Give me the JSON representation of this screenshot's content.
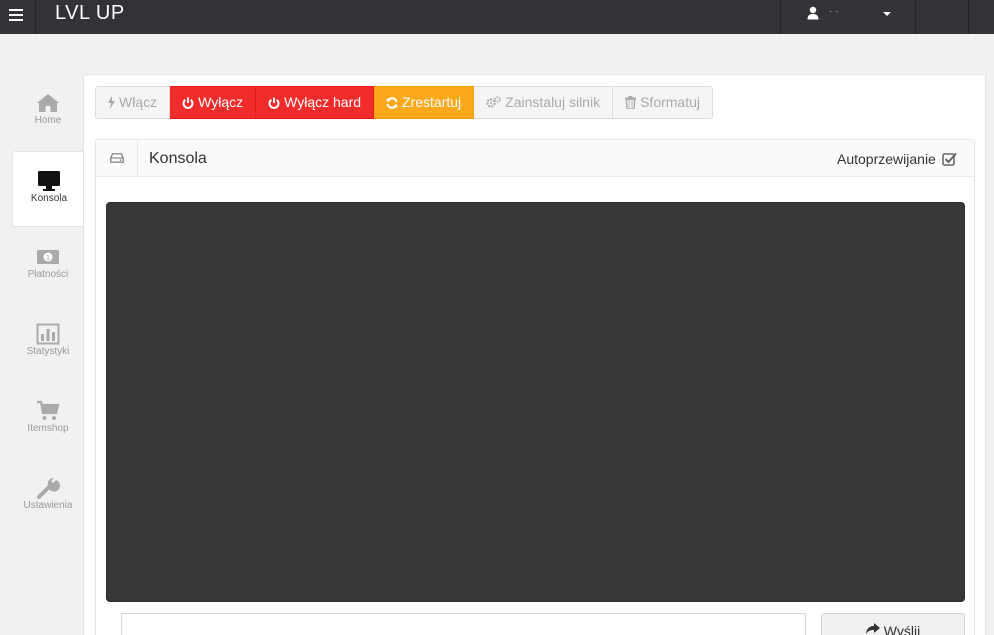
{
  "topbar": {
    "brand": "LVL UP",
    "user_name": "· ·"
  },
  "sidebar": {
    "items": [
      {
        "label": "Home",
        "icon": "home-icon",
        "active": false
      },
      {
        "label": "Konsola",
        "icon": "monitor-icon",
        "active": true
      },
      {
        "label": "Płatności",
        "icon": "money-icon",
        "active": false
      },
      {
        "label": "Statystyki",
        "icon": "bar-chart-icon",
        "active": false
      },
      {
        "label": "Itemshop",
        "icon": "cart-icon",
        "active": false
      },
      {
        "label": "Ustawienia",
        "icon": "wrench-icon",
        "active": false
      }
    ]
  },
  "toolbar": {
    "start_label": "Włącz",
    "stop_label": "Wyłącz",
    "stop_hard_label": "Wyłącz hard",
    "restart_label": "Zrestartuj",
    "install_label": "Zainstaluj silnik",
    "format_label": "Sformatuj"
  },
  "console": {
    "title": "Konsola",
    "autoscroll_label": "Autoprzewijanie",
    "autoscroll_checked": true,
    "input_value": "",
    "send_label": "Wyślij"
  },
  "colors": {
    "topbar": "#333237",
    "danger": "#f22b2b",
    "warning": "#fba81b",
    "terminal": "#383838"
  }
}
